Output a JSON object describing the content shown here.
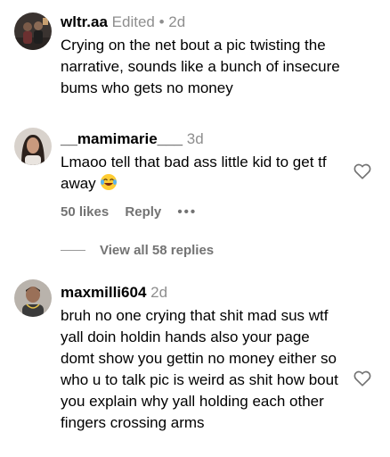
{
  "comments": [
    {
      "username": "wltr.aa",
      "edited_label": "Edited",
      "separator": "•",
      "time": "2d",
      "text": "Crying on the net bout a pic twisting the narrative, sounds like a bunch of insecure bums who gets no money",
      "avatar_icon": "avatar-couple-photo"
    },
    {
      "username": "__mamimarie___",
      "time": "3d",
      "text": "Lmaoo tell that bad ass little kid to get tf away",
      "emoji_icon": "laughing-crying-emoji",
      "likes_label": "50 likes",
      "reply_label": "Reply",
      "more_icon": "more-options-icon",
      "avatar_icon": "avatar-woman-photo"
    },
    {
      "view_replies_label": "View all 58 replies"
    },
    {
      "username": "maxmilli604",
      "time": "2d",
      "text": "bruh no one crying that shit mad sus wtf yall doin holdin hands also your page domt show you gettin no money either so who u to talk pic is weird as shit how bout you explain why yall holding each other fingers crossing arms",
      "avatar_icon": "avatar-man-photo"
    }
  ],
  "colors": {
    "muted": "#8e8e8e",
    "action": "#737373"
  }
}
